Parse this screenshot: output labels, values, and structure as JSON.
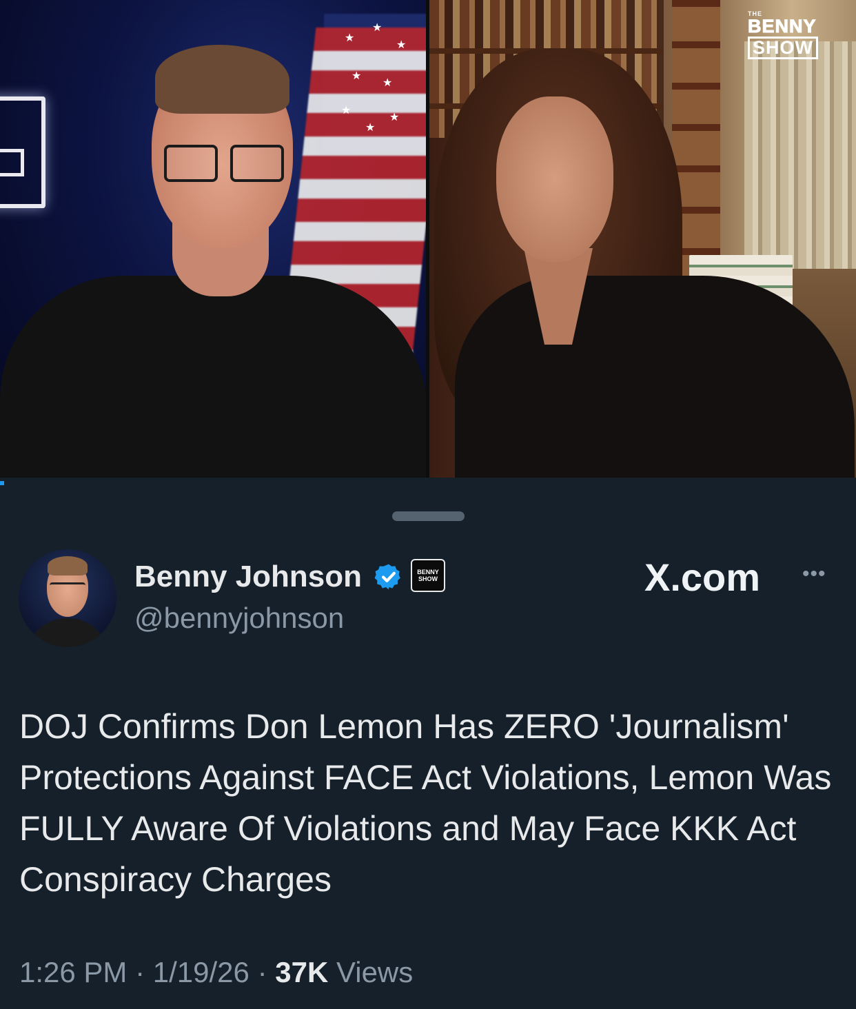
{
  "video": {
    "logo": {
      "the": "THE",
      "line1": "BENNY",
      "line2": "SHOW"
    }
  },
  "post": {
    "author_name": "Benny Johnson",
    "affiliate_badge": {
      "line1": "BENNY",
      "line2": "SHOW"
    },
    "handle": "@bennyjohnson",
    "source": "X.com",
    "more_icon": "more-horizontal-icon",
    "text": "DOJ Confirms Don Lemon Has ZERO 'Journalism' Protections Against FACE Act Violations, Lemon Was FULLY Aware Of Violations and May Face KKK Act Conspiracy Charges",
    "time": "1:26 PM",
    "date": "1/19/26",
    "views_count": "37K",
    "views_label": "Views",
    "separator": "·"
  },
  "colors": {
    "background": "#15202b",
    "verified_blue": "#1d9bf0",
    "secondary_text": "#8b98a5",
    "primary_text": "#e7e9ea"
  }
}
